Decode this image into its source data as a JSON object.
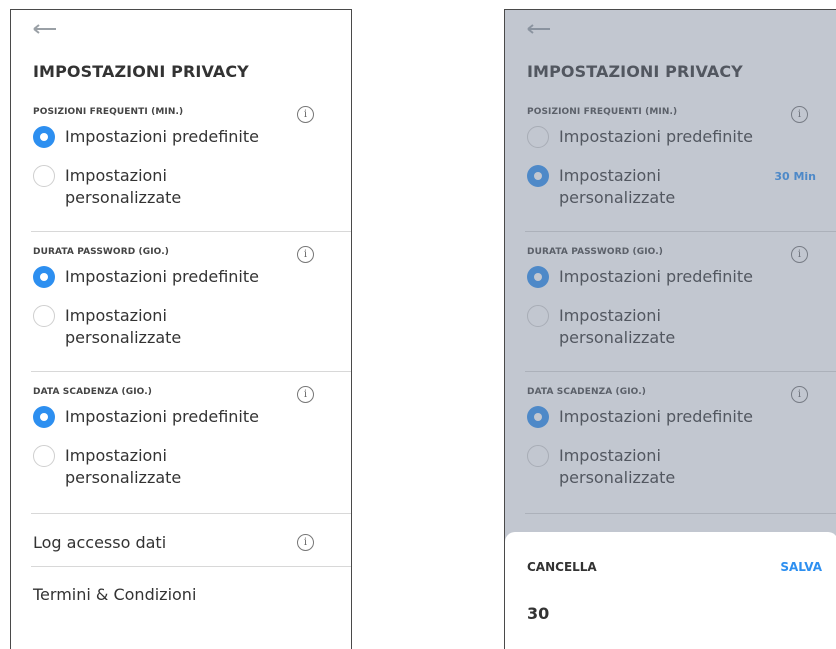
{
  "title": "IMPOSTAZIONI PRIVACY",
  "sections": [
    {
      "label": "POSIZIONI FREQUENTI (MIN.)",
      "default_option": "Impostazioni predefinite",
      "custom_option_line1": "Impostazioni",
      "custom_option_line2": "personalizzate"
    },
    {
      "label": "DURATA PASSWORD (GIO.)",
      "default_option": "Impostazioni predefinite",
      "custom_option_line1": "Impostazioni",
      "custom_option_line2": "personalizzate"
    },
    {
      "label": "DATA SCADENZA (GIO.)",
      "default_option": "Impostazioni predefinite",
      "custom_option_line1": "Impostazioni",
      "custom_option_line2": "personalizzate"
    }
  ],
  "info_glyph": "i",
  "rows": {
    "data_access_log": "Log accesso dati",
    "terms": "Termini & Condizioni"
  },
  "custom_value_badge": "30 Min",
  "sheet": {
    "cancel": "CANCELLA",
    "save": "SALVA",
    "value": "30"
  },
  "colors": {
    "accent": "#2d8ff0",
    "text": "#333333",
    "overlay": "#7882961f"
  },
  "icons": {
    "back": "back-arrow-icon",
    "info": "info-icon"
  }
}
